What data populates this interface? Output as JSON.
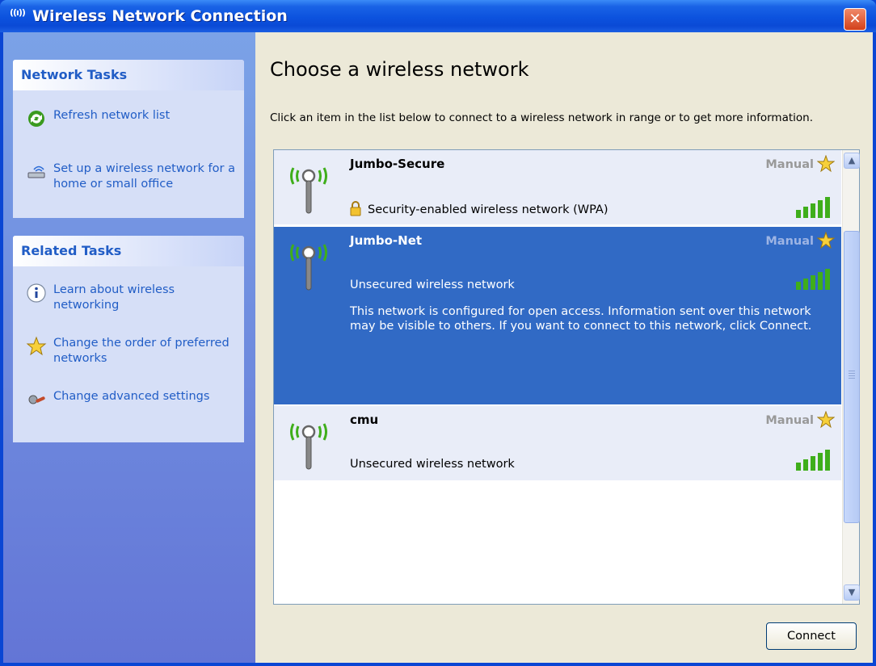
{
  "window": {
    "title": "Wireless Network Connection",
    "title_icon": "((ı))",
    "close_icon": "✕"
  },
  "sidebar": {
    "network_tasks": {
      "header": "Network Tasks",
      "items": [
        {
          "label": "Refresh network list",
          "icon": "refresh-icon"
        },
        {
          "label": "Set up a wireless network for a home or small office",
          "icon": "wireless-setup-icon"
        }
      ]
    },
    "related_tasks": {
      "header": "Related Tasks",
      "items": [
        {
          "label": "Learn about wireless networking",
          "icon": "info-icon"
        },
        {
          "label": "Change the order of preferred networks",
          "icon": "star-icon"
        },
        {
          "label": "Change advanced settings",
          "icon": "settings-icon"
        }
      ]
    }
  },
  "main": {
    "heading": "Choose a wireless network",
    "instructions": "Click an item in the list below to connect to a wireless network in range or to get more information.",
    "networks": [
      {
        "name": "Jumbo-Secure",
        "mode": "Manual",
        "status": "Security-enabled wireless network (WPA)",
        "secured": true,
        "signal": "excellent"
      },
      {
        "name": "Jumbo-Net",
        "mode": "Manual",
        "status": "Unsecured wireless network",
        "description": "This network is configured for open access. Information sent over this network may be visible to others. If you want to connect to this network, click Connect.",
        "selected": true,
        "signal": "excellent"
      },
      {
        "name": "cmu",
        "mode": "Manual",
        "status": "Unsecured wireless network",
        "signal": "excellent"
      }
    ],
    "connect_button": "Connect"
  },
  "colors": {
    "title_bar": "#0a4ad6",
    "sidebar": "#7ba2e7",
    "task_text": "#215dc6",
    "selection": "#316ac5",
    "signal_bars": "#3fae1b"
  }
}
